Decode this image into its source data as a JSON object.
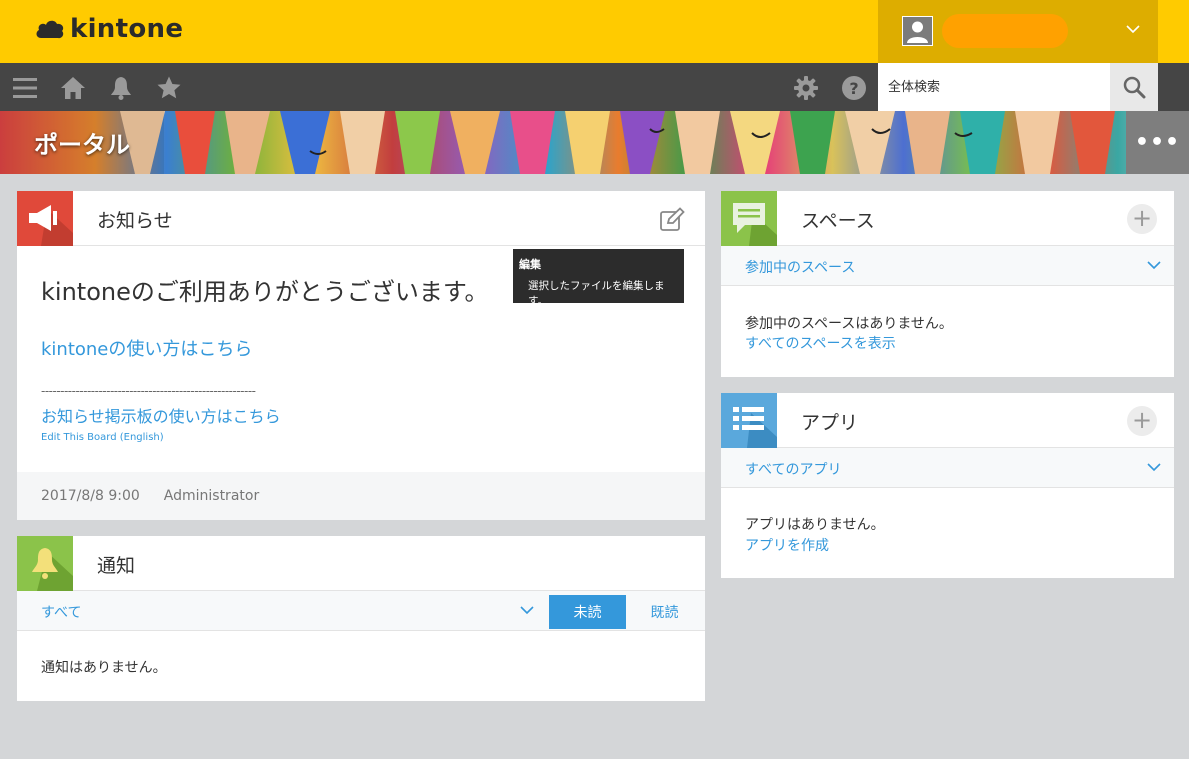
{
  "header": {
    "logo_text": "kintone",
    "search_placeholder": "全体検索"
  },
  "nav": {
    "icons": [
      "menu-icon",
      "home-icon",
      "bell-icon",
      "star-icon",
      "gear-icon",
      "help-icon",
      "search-icon"
    ]
  },
  "banner": {
    "title": "ポータル",
    "more_label": "•••"
  },
  "notice": {
    "title": "お知らせ",
    "lead": "kintoneのご利用ありがとうございます。",
    "link_howto": "kintoneの使い方はこちら",
    "divider": "--------------------------------------------------------",
    "link_board": "お知らせ掲示板の使い方はこちら",
    "link_edit_board": "Edit This Board (English)",
    "date": "2017/8/8 9:00",
    "author": "Administrator"
  },
  "tooltip": {
    "title": "編集",
    "description": "選択したファイルを編集します。"
  },
  "notifications": {
    "title": "通知",
    "filter_label": "すべて",
    "tab_unread": "未読",
    "tab_read": "既読",
    "empty_text": "通知はありません。"
  },
  "spaces": {
    "title": "スペース",
    "filter_label": "参加中のスペース",
    "empty_text": "参加中のスペースはありません。",
    "link_all": "すべてのスペースを表示"
  },
  "apps": {
    "title": "アプリ",
    "filter_label": "すべてのアプリ",
    "empty_text": "アプリはありません。",
    "link_create": "アプリを作成"
  },
  "colors": {
    "header_yellow": "#ffcb00",
    "user_area": "#ddad00",
    "nav_dark": "#454545",
    "link_blue": "#3498db",
    "notice_icon_red": "#e0493a",
    "notify_icon_green": "#8bc34a",
    "space_icon_green": "#8bc34a",
    "app_icon_blue": "#5aa8dc",
    "tab_active": "#3498db"
  }
}
